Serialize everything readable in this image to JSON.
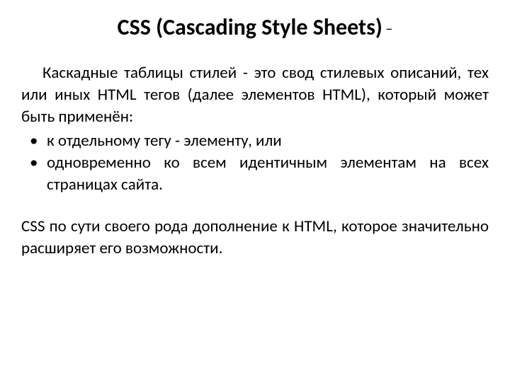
{
  "title_main": "CSS (Cascading Style Sheets)",
  "title_dash": " –",
  "paragraph1": "Каскадные таблицы стилей - это свод стилевых описаний, тех или иных HTML тегов (далее элементов HTML), который может быть применён:",
  "bullets": [
    "к отдельному тегу - элементу, или",
    "одновременно ко всем идентичным элементам на всех страницах сайта."
  ],
  "paragraph2": "CSS по сути своего рода дополнение к HTML, которое значительно расширяет его возможности."
}
